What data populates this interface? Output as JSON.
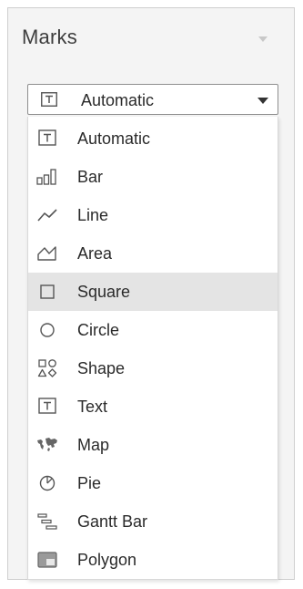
{
  "panel": {
    "title": "Marks"
  },
  "mark_type_select": {
    "selected": "Automatic",
    "icon": "text-t-icon"
  },
  "menu": {
    "highlighted_index": 4,
    "items": [
      {
        "label": "Automatic",
        "icon": "text-t-icon"
      },
      {
        "label": "Bar",
        "icon": "bar-chart-icon"
      },
      {
        "label": "Line",
        "icon": "line-chart-icon"
      },
      {
        "label": "Area",
        "icon": "area-chart-icon"
      },
      {
        "label": "Square",
        "icon": "square-icon"
      },
      {
        "label": "Circle",
        "icon": "circle-icon"
      },
      {
        "label": "Shape",
        "icon": "shapes-icon"
      },
      {
        "label": "Text",
        "icon": "text-t-icon"
      },
      {
        "label": "Map",
        "icon": "map-icon"
      },
      {
        "label": "Pie",
        "icon": "pie-icon"
      },
      {
        "label": "Gantt Bar",
        "icon": "gantt-bar-icon"
      },
      {
        "label": "Polygon",
        "icon": "polygon-icon"
      }
    ]
  },
  "colors": {
    "highlight": "#e4e4e4",
    "panel_bg": "#f4f4f4",
    "icon_stroke": "#555555"
  }
}
